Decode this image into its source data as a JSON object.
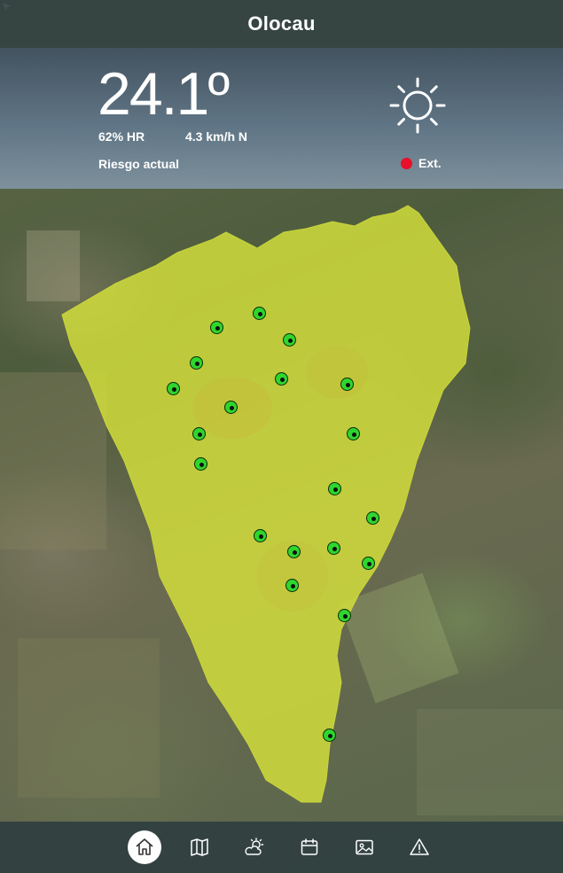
{
  "header": {
    "title": "Olocau"
  },
  "weather": {
    "temperature": "24.1º",
    "humidity": "62% HR",
    "wind": "4.3 km/h N",
    "risk_label": "Riesgo actual",
    "risk_level": "Ext.",
    "risk_color": "#e8102a",
    "condition_icon": "sun-icon"
  },
  "map": {
    "area_color": "#d6e23a",
    "marker_color": "#2ed62e",
    "marker_count": 21
  },
  "nav": {
    "items": [
      {
        "name": "home-icon",
        "active": true
      },
      {
        "name": "map-icon",
        "active": false
      },
      {
        "name": "weather-icon",
        "active": false
      },
      {
        "name": "calendar-icon",
        "active": false
      },
      {
        "name": "gallery-icon",
        "active": false
      },
      {
        "name": "warning-icon",
        "active": false
      }
    ]
  }
}
